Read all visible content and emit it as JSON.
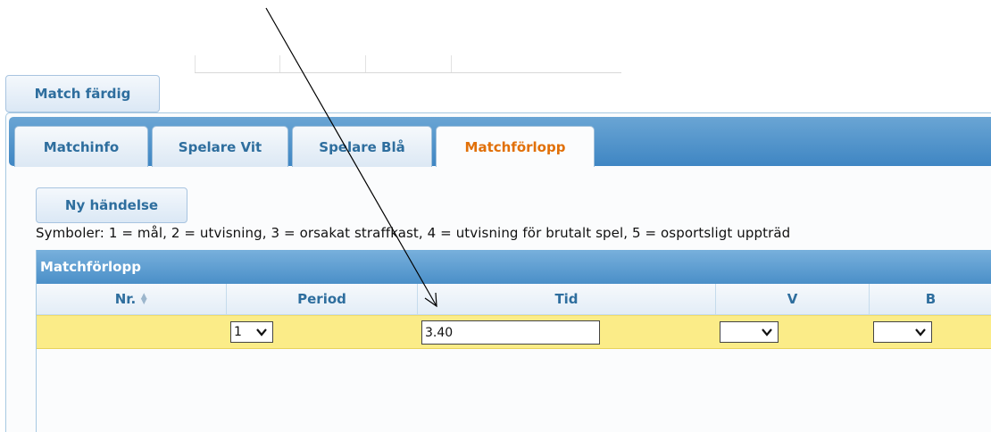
{
  "top": {
    "match_done_button": "Match färdig"
  },
  "tabs": [
    {
      "label": "Matchinfo",
      "active": false
    },
    {
      "label": "Spelare Vit",
      "active": false
    },
    {
      "label": "Spelare Blå",
      "active": false
    },
    {
      "label": "Matchförlopp",
      "active": true
    }
  ],
  "content": {
    "new_event_button": "Ny händelse",
    "symbols_text": "Symboler: 1 = mål, 2 = utvisning, 3 = orsakat straffkast, 4 = utvisning för brutalt spel, 5 = osportsligt uppträd"
  },
  "grid": {
    "caption": "Matchförlopp",
    "columns": [
      "Nr.",
      "Period",
      "Tid",
      "V",
      "B"
    ],
    "rows": [
      {
        "nr": "",
        "period": "1",
        "tid": "3.40",
        "v": "",
        "b": ""
      }
    ]
  },
  "colors": {
    "tab_active_text": "#e17009",
    "header_text": "#2e6e9e",
    "row_highlight": "#fbec88",
    "tabbar_blue": "#3f86c3"
  }
}
